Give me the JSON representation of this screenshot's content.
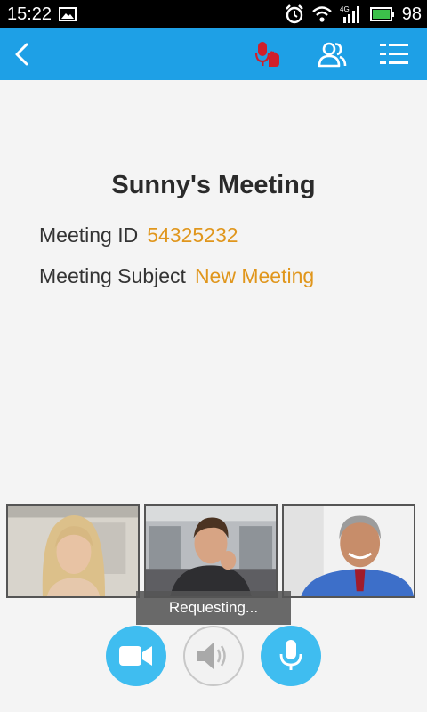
{
  "status_bar": {
    "time": "15:22",
    "battery": "98",
    "network": "4G",
    "icons": [
      "image-icon",
      "alarm-icon",
      "wifi-icon",
      "signal-icon",
      "battery-icon"
    ]
  },
  "toolbar": {
    "icons": [
      "back-arrow-icon",
      "raise-hand-icon",
      "participants-icon",
      "menu-icon"
    ],
    "hand_icon_color": "#d01f2a",
    "background": "#1ea0e6"
  },
  "meeting": {
    "title": "Sunny's Meeting",
    "id_label": "Meeting ID",
    "id_value": "54325232",
    "subject_label": "Meeting Subject",
    "subject_value": "New Meeting"
  },
  "participants": [
    "participant-video-1",
    "participant-video-2",
    "participant-video-3"
  ],
  "toast": {
    "text": "Requesting..."
  },
  "controls": {
    "icons": [
      "video-camera-icon",
      "speaker-icon",
      "microphone-icon"
    ],
    "accent": "#3fbdf0"
  }
}
